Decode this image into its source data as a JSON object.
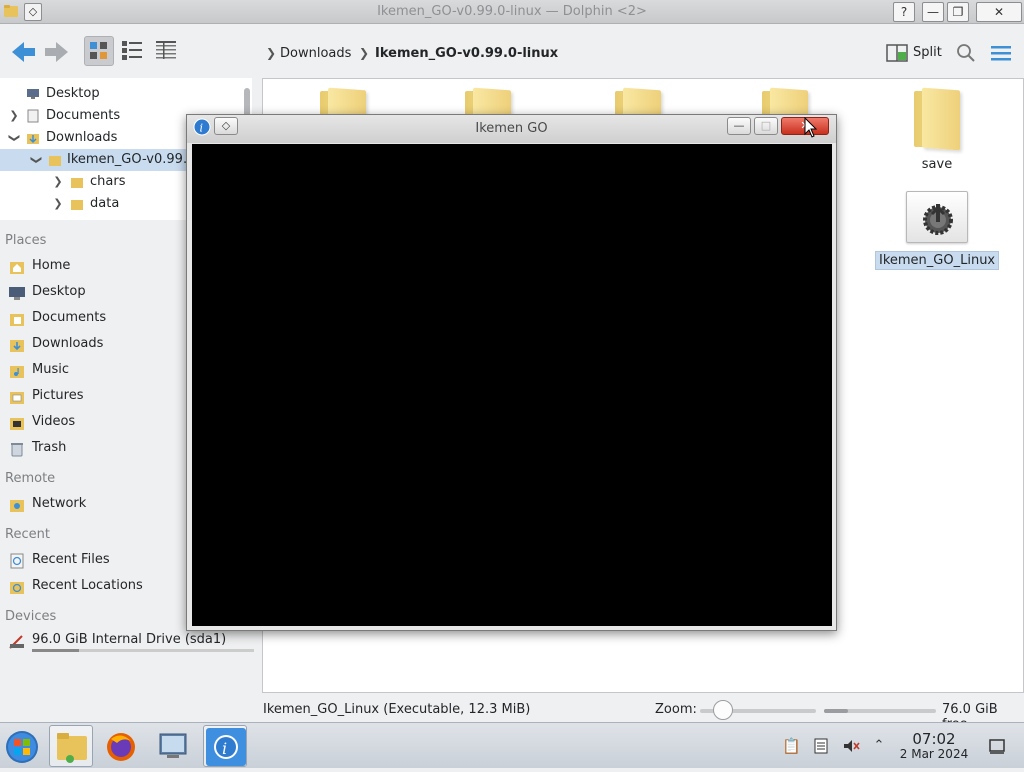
{
  "window": {
    "title": "Ikemen_GO-v0.99.0-linux — Dolphin <2>",
    "menu_glyph": "◇",
    "help_glyph": "?",
    "minimize_glyph": "—",
    "maximize_glyph": "❐",
    "close_glyph": "✕"
  },
  "toolbar": {
    "breadcrumb": [
      "Downloads",
      "Ikemen_GO-v0.99.0-linux"
    ],
    "split_label": "Split"
  },
  "folder_tree": [
    {
      "label": "Desktop"
    },
    {
      "label": "Documents"
    },
    {
      "label": "Downloads"
    },
    {
      "label": "Ikemen_GO-v0.99.0-linux"
    },
    {
      "label": "chars"
    },
    {
      "label": "data"
    }
  ],
  "places": {
    "header": "Places",
    "items": [
      "Home",
      "Desktop",
      "Documents",
      "Downloads",
      "Music",
      "Pictures",
      "Videos",
      "Trash"
    ]
  },
  "remote": {
    "header": "Remote",
    "items": [
      "Network"
    ]
  },
  "recent": {
    "header": "Recent",
    "items": [
      "Recent Files",
      "Recent Locations"
    ]
  },
  "devices": {
    "header": "Devices",
    "items": [
      "96.0 GiB Internal Drive (sda1)"
    ]
  },
  "files": {
    "save_label": "save",
    "exec_label": "Ikemen_GO_Linux"
  },
  "statusbar": {
    "info": "Ikemen_GO_Linux (Executable, 12.3 MiB)",
    "zoom_label": "Zoom:",
    "free_space": "76.0 GiB free",
    "zoom_level": 0.2,
    "disk_used_fraction": 0.21
  },
  "ikemen_window": {
    "title": "Ikemen GO",
    "minimize_glyph": "—",
    "maximize_glyph": "□",
    "close_glyph": "✕"
  },
  "taskbar": {
    "time": "07:02",
    "date": "2 Mar 2024"
  },
  "colors": {
    "selection": "#c9dcef",
    "accent_blue": "#3d8fd6",
    "folder_yellow": "#f2d67f",
    "close_red": "#d8412f"
  }
}
